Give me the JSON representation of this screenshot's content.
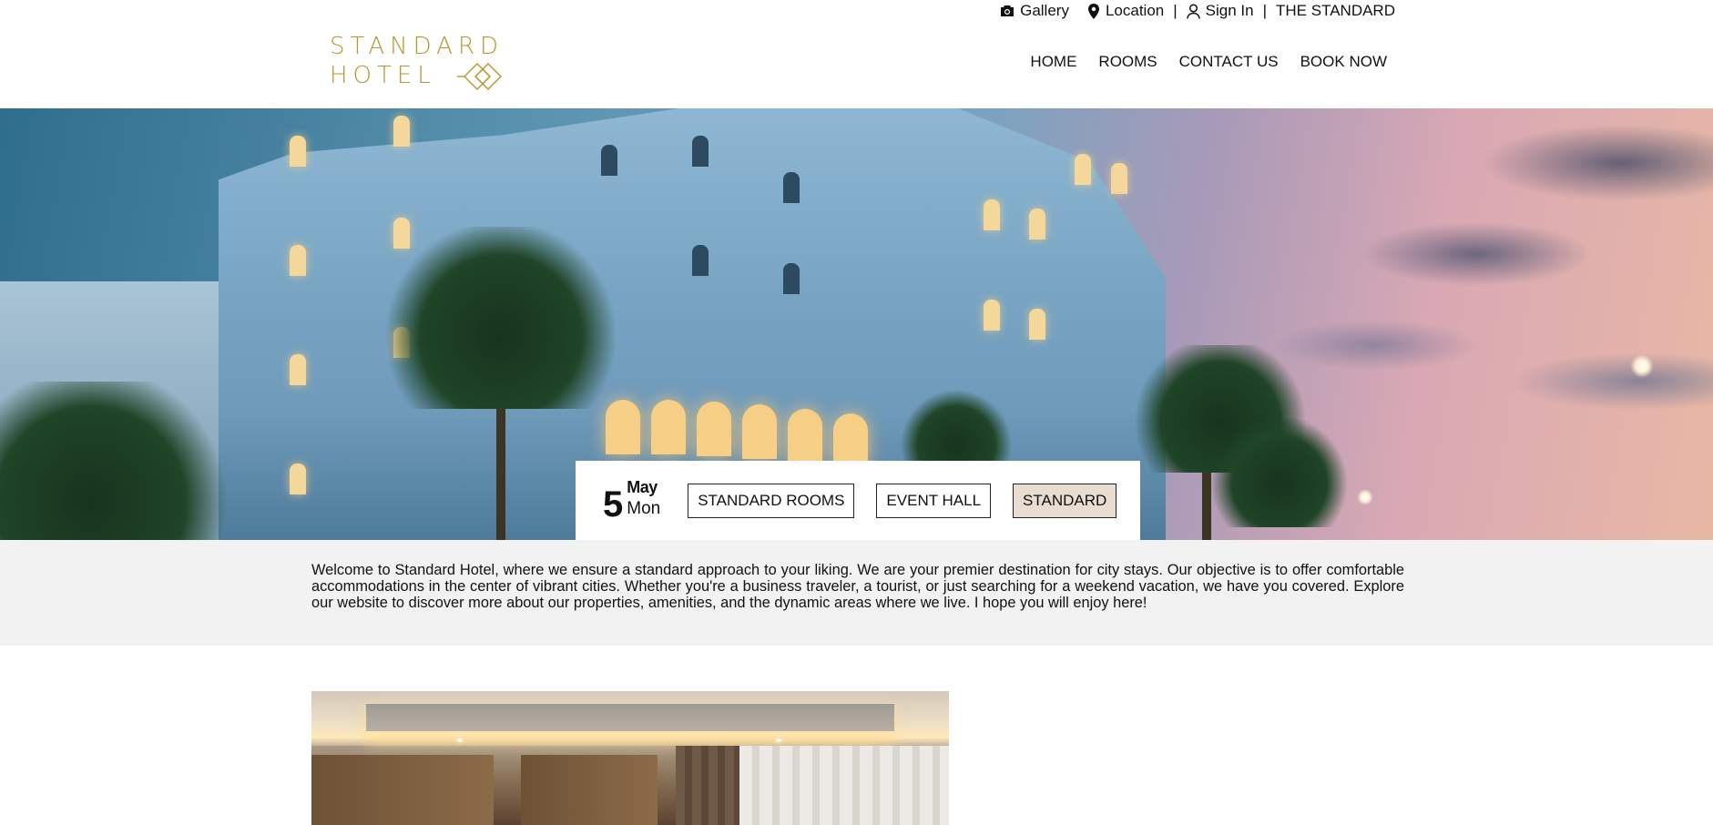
{
  "utility": {
    "gallery_label": "Gallery",
    "location_label": "Location",
    "separator": "|",
    "signin_label": "Sign In",
    "brand_label": "THE STANDARD",
    "icons": [
      "camera-icon",
      "map-pin-icon",
      "user-icon"
    ]
  },
  "logo": {
    "line1": "STANDARD",
    "line2": "HOTEL",
    "color": "#b8962e"
  },
  "nav": {
    "home": "HOME",
    "rooms": "ROOMS",
    "contact": "CONTACT US",
    "book": "BOOK NOW"
  },
  "booking": {
    "day": "5",
    "month": "May",
    "weekday": "Mon",
    "buttons": {
      "standard_rooms": "STANDARD ROOMS",
      "event_hall": "EVENT HALL",
      "standard": "STANDARD"
    },
    "active_color": "#e8ddd0"
  },
  "intro": {
    "text": "Welcome to Standard Hotel, where we ensure a standard approach to your liking. We are your premier destination for city stays. Our objective is to offer comfortable accommodations in the center of vibrant cities. Whether you're a business traveler, a tourist, or just searching for a weekend vacation, we have you covered. Explore our website to discover more about our properties, amenities, and the dynamic areas where we live. I hope you will enjoy here!"
  }
}
